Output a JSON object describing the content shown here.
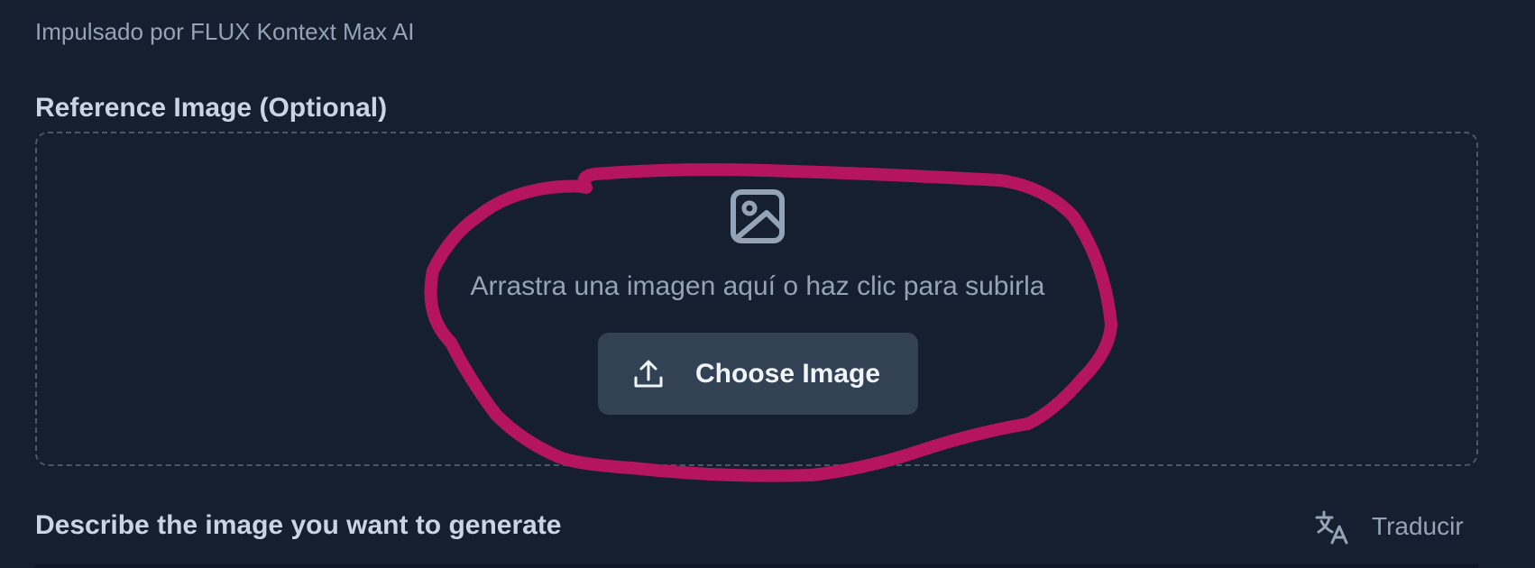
{
  "header": {
    "powered_by": "Impulsado por FLUX Kontext Max AI"
  },
  "reference_image": {
    "label": "Reference Image (Optional)",
    "drop_hint": "Arrastra una imagen aquí o haz clic para subirla",
    "choose_button_label": "Choose Image",
    "image_icon": "image-icon",
    "upload_icon": "upload-icon"
  },
  "prompt_section": {
    "label": "Describe the image you want to generate",
    "translate_label": "Traducir",
    "translate_icon": "translate-icon"
  },
  "colors": {
    "background": "#161f30",
    "button_bg": "#334155",
    "muted_text": "#94a3b8",
    "annotation_stroke": "#b5155e"
  }
}
